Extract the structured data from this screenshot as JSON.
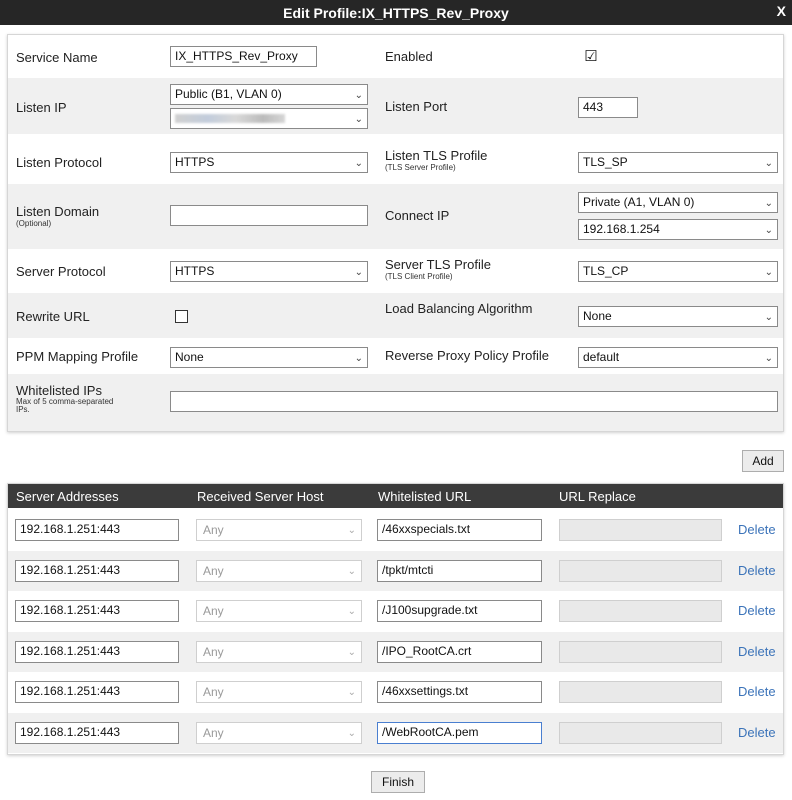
{
  "dialog": {
    "title": "Edit Profile:IX_HTTPS_Rev_Proxy",
    "close": "X"
  },
  "form": {
    "service_name": {
      "label": "Service Name",
      "value": "IX_HTTPS_Rev_Proxy"
    },
    "enabled": {
      "label": "Enabled",
      "checked": "☑"
    },
    "listen_ip": {
      "label": "Listen IP",
      "interface": "Public (B1, VLAN 0)"
    },
    "listen_port": {
      "label": "Listen Port",
      "value": "443"
    },
    "listen_protocol": {
      "label": "Listen Protocol",
      "value": "HTTPS"
    },
    "listen_tls_profile": {
      "label": "Listen TLS Profile",
      "sub": "(TLS Server Profile)",
      "value": "TLS_SP"
    },
    "listen_domain": {
      "label": "Listen Domain",
      "sub": "(Optional)",
      "value": ""
    },
    "connect_ip": {
      "label": "Connect IP",
      "interface": "Private (A1, VLAN 0)",
      "address": "192.168.1.254"
    },
    "server_protocol": {
      "label": "Server Protocol",
      "value": "HTTPS"
    },
    "server_tls_profile": {
      "label": "Server TLS Profile",
      "sub": "(TLS Client Profile)",
      "value": "TLS_CP"
    },
    "rewrite_url": {
      "label": "Rewrite URL"
    },
    "load_balancing": {
      "label": "Load Balancing Algorithm",
      "value": "None"
    },
    "ppm_mapping": {
      "label": "PPM Mapping Profile",
      "value": "None"
    },
    "reverse_proxy_policy": {
      "label": "Reverse Proxy Policy Profile",
      "value": "default"
    },
    "whitelisted_ips": {
      "label": "Whitelisted IPs",
      "sub": "Max of 5 comma-separated IPs.",
      "value": ""
    }
  },
  "add_button": "Add",
  "servers": {
    "headers": [
      "Server Addresses",
      "Received Server Host",
      "Whitelisted URL",
      "URL Replace"
    ],
    "rows": [
      {
        "address": "192.168.1.251:443",
        "host": "Any",
        "url": "/46xxspecials.txt",
        "delete": "Delete"
      },
      {
        "address": "192.168.1.251:443",
        "host": "Any",
        "url": "/tpkt/mtcti",
        "delete": "Delete"
      },
      {
        "address": "192.168.1.251:443",
        "host": "Any",
        "url": "/J100supgrade.txt",
        "delete": "Delete"
      },
      {
        "address": "192.168.1.251:443",
        "host": "Any",
        "url": "/IPO_RootCA.crt",
        "delete": "Delete"
      },
      {
        "address": "192.168.1.251:443",
        "host": "Any",
        "url": "/46xxsettings.txt",
        "delete": "Delete"
      },
      {
        "address": "192.168.1.251:443",
        "host": "Any",
        "url": "/WebRootCA.pem",
        "delete": "Delete"
      }
    ]
  },
  "finish_button": "Finish",
  "icons": {
    "dropdown": "chevron-down-icon",
    "close": "close-icon"
  }
}
